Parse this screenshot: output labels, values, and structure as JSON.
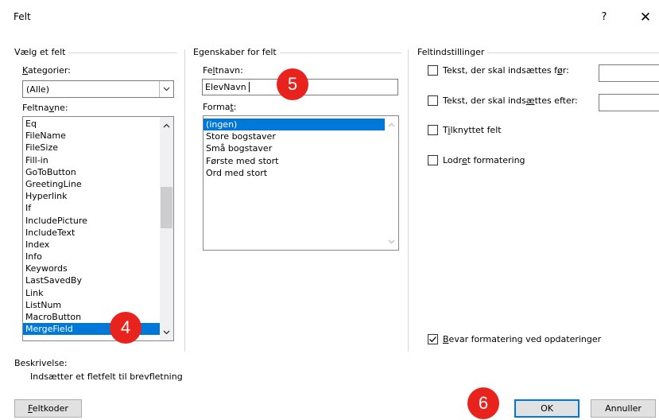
{
  "window": {
    "title": "Felt",
    "help_glyph": "?",
    "close_glyph": "✕"
  },
  "left_group": {
    "title": "Vælg et felt",
    "categories_label_pre": "",
    "categories_label_mn": "K",
    "categories_label_post": "ategorier:",
    "categories_value": "(Alle)",
    "fieldnames_label_pre": "Feltna",
    "fieldnames_label_mn": "v",
    "fieldnames_label_post": "ne:",
    "fieldnames": [
      "Eq",
      "FileName",
      "FileSize",
      "Fill-in",
      "GoToButton",
      "GreetingLine",
      "Hyperlink",
      "If",
      "IncludePicture",
      "IncludeText",
      "Index",
      "Info",
      "Keywords",
      "LastSavedBy",
      "Link",
      "ListNum",
      "MacroButton",
      "MergeField"
    ],
    "selected_fieldname": "MergeField"
  },
  "middle_group": {
    "title": "Egenskaber for felt",
    "fieldname_label_pre": "Fe",
    "fieldname_label_mn": "l",
    "fieldname_label_post": "tnavn:",
    "fieldname_value": "ElevNavn",
    "format_label_pre": "Forma",
    "format_label_mn": "t",
    "format_label_post": ":",
    "formats": [
      "(ingen)",
      "Store bogstaver",
      "Små bogstaver",
      "Første med stort",
      "Ord med stort"
    ],
    "selected_format": "(ingen)"
  },
  "right_group": {
    "title": "Feltindstillinger",
    "opt_before_pre": "Tekst, der skal indsættes f",
    "opt_before_mn": "ø",
    "opt_before_post": "r:",
    "opt_after_pre": "Tekst, der skal inds",
    "opt_after_mn": "æ",
    "opt_after_post": "ttes efter:",
    "opt_attached_pre": "T",
    "opt_attached_mn": "i",
    "opt_attached_post": "lknyttet felt",
    "opt_vertical_pre": "Lodr",
    "opt_vertical_mn": "e",
    "opt_vertical_post": "t formatering",
    "preserve_pre": "",
    "preserve_mn": "B",
    "preserve_post": "evar formatering ved opdateringer",
    "preserve_checked": true
  },
  "description": {
    "label": "Beskrivelse:",
    "text": "Indsætter et fletfelt til brevfletning"
  },
  "buttons": {
    "field_codes_pre": "",
    "field_codes_mn": "F",
    "field_codes_post": "eltkoder",
    "ok": "OK",
    "cancel": "Annuller"
  },
  "callouts": {
    "step4": "4",
    "step5": "5",
    "step6": "6",
    "color": "#e8231d"
  },
  "colors": {
    "selection": "#0078d7",
    "default_button_border": "#0078d7"
  }
}
